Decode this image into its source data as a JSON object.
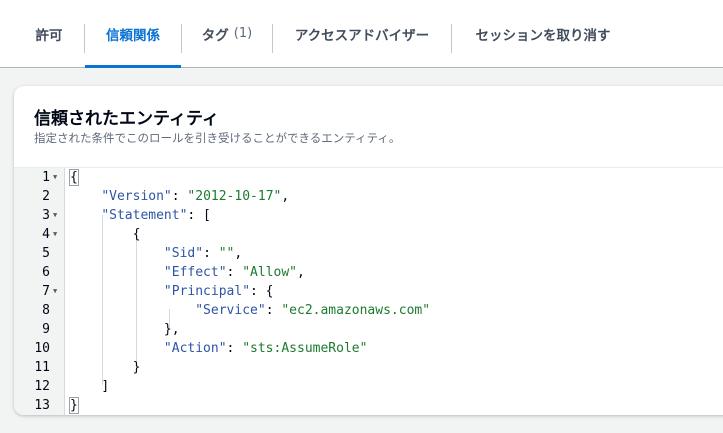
{
  "tabs": [
    {
      "label": "許可",
      "count": ""
    },
    {
      "label": "信頼関係",
      "count": ""
    },
    {
      "label": "タグ",
      "count": "(1)"
    },
    {
      "label": "アクセスアドバイザー",
      "count": ""
    },
    {
      "label": "セッションを取り消す",
      "count": ""
    }
  ],
  "active_tab": "信頼関係",
  "panel": {
    "title": "信頼されたエンティティ",
    "description": "指定された条件でこのロールを引き受けることができるエンティティ。"
  },
  "editor": {
    "lines": [
      {
        "number": "1",
        "foldable": true
      },
      {
        "number": "2",
        "foldable": false
      },
      {
        "number": "3",
        "foldable": true
      },
      {
        "number": "4",
        "foldable": true
      },
      {
        "number": "5",
        "foldable": false
      },
      {
        "number": "6",
        "foldable": false
      },
      {
        "number": "7",
        "foldable": true
      },
      {
        "number": "8",
        "foldable": false
      },
      {
        "number": "9",
        "foldable": false
      },
      {
        "number": "10",
        "foldable": false
      },
      {
        "number": "11",
        "foldable": false
      },
      {
        "number": "12",
        "foldable": false
      },
      {
        "number": "13",
        "foldable": false
      }
    ],
    "tokens": {
      "version_key": "\"Version\"",
      "version_val": "\"2012-10-17\"",
      "statement_key": "\"Statement\"",
      "sid_key": "\"Sid\"",
      "sid_val": "\"\"",
      "effect_key": "\"Effect\"",
      "effect_val": "\"Allow\"",
      "principal_key": "\"Principal\"",
      "service_key": "\"Service\"",
      "service_val": "\"ec2.amazonaws.com\"",
      "action_key": "\"Action\"",
      "action_val": "\"sts:AssumeRole\""
    }
  }
}
